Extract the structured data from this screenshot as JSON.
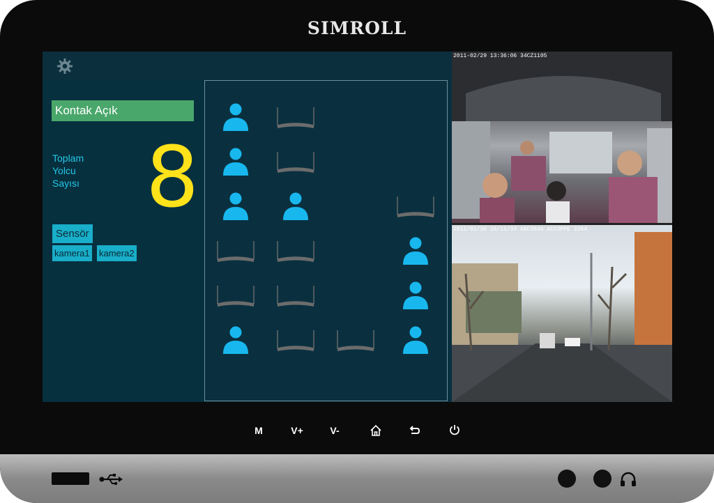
{
  "device": {
    "brand": "SIMROLL",
    "buttons": {
      "m": "M",
      "vplus": "V+",
      "vminus": "V-"
    }
  },
  "app": {
    "kontak_status": "Kontak Açık",
    "passenger_label": "Toplam\nYolcu\nSayısı",
    "passenger_count": "8",
    "sensor_button": "Sensör",
    "camera_buttons": [
      "kamera1",
      "kamera2"
    ]
  },
  "seats": [
    {
      "state": "occupied"
    },
    {
      "state": "empty"
    },
    {
      "state": "none"
    },
    {
      "state": "none"
    },
    {
      "state": "occupied"
    },
    {
      "state": "empty"
    },
    {
      "state": "none"
    },
    {
      "state": "none"
    },
    {
      "state": "occupied"
    },
    {
      "state": "occupied"
    },
    {
      "state": "none"
    },
    {
      "state": "empty"
    },
    {
      "state": "empty"
    },
    {
      "state": "empty"
    },
    {
      "state": "none"
    },
    {
      "state": "occupied"
    },
    {
      "state": "empty"
    },
    {
      "state": "empty"
    },
    {
      "state": "none"
    },
    {
      "state": "occupied"
    },
    {
      "state": "occupied"
    },
    {
      "state": "empty"
    },
    {
      "state": "empty"
    },
    {
      "state": "occupied"
    }
  ],
  "cameras": {
    "cam1_osd": "2011-02/29 13:36:06         34CZ1105",
    "cam2_osd": "2011/01/30 16/11/33    ABC3846 ACCOPPE  2264"
  },
  "colors": {
    "occupied": "#18b8ef",
    "empty_seat": "#6c6c6c",
    "accent_green": "#4aa76b",
    "count_yellow": "#ffe21a"
  }
}
